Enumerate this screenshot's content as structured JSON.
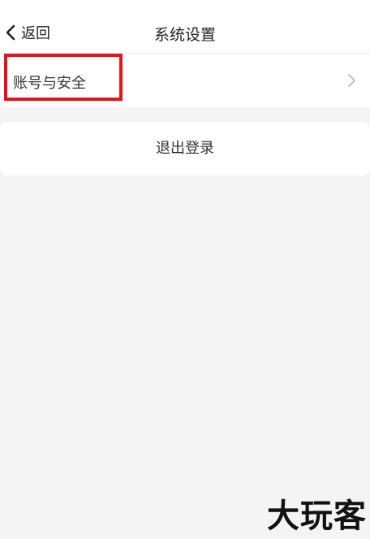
{
  "nav": {
    "back_icon": "chevron-left-icon",
    "back_label": "返回",
    "title": "系统设置"
  },
  "settings": {
    "items": [
      {
        "label": "账号与安全",
        "icon": "chevron-right-icon"
      }
    ]
  },
  "logout": {
    "label": "退出登录"
  },
  "watermark": {
    "text": "大玩客"
  },
  "colors": {
    "background": "#f4f4f4",
    "card": "#ffffff",
    "highlight": "#e8101a",
    "text": "#222222",
    "chevron": "#b8b8b8"
  }
}
